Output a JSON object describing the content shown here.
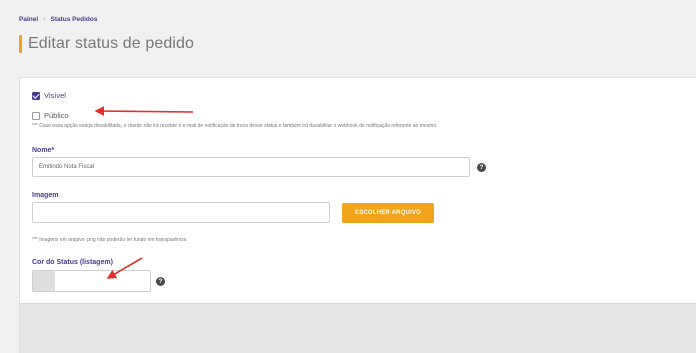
{
  "breadcrumb": {
    "home": "Painel",
    "separator": "›",
    "current": "Status Pedidos"
  },
  "page": {
    "title": "Editar status de pedido"
  },
  "form": {
    "visible": {
      "label": "Visível",
      "checked": true
    },
    "public": {
      "label": "Público",
      "checked": false
    },
    "public_note": "*** Caso essa opção esteja desabilitada, o cliente não irá receber o e-mail de notificação de troca desse status e também irá dasabilitar o webhook de notificação referente ao mesmo.",
    "name": {
      "label": "Nome*",
      "value": "Emitindo Nota Fiscal",
      "help": "?"
    },
    "image": {
      "label": "Imagem",
      "value": "",
      "button": "ESCOLHER ARQUIVO"
    },
    "image_note": "*** Imagens em arquivo .png não poderão ter fundo em transparência",
    "color": {
      "label": "Cor do Status (listagem)",
      "value": "",
      "help": "?"
    }
  },
  "colors": {
    "brand": "#4a3a8c",
    "accent": "#f0a41c",
    "annotation": "#e0312b"
  }
}
